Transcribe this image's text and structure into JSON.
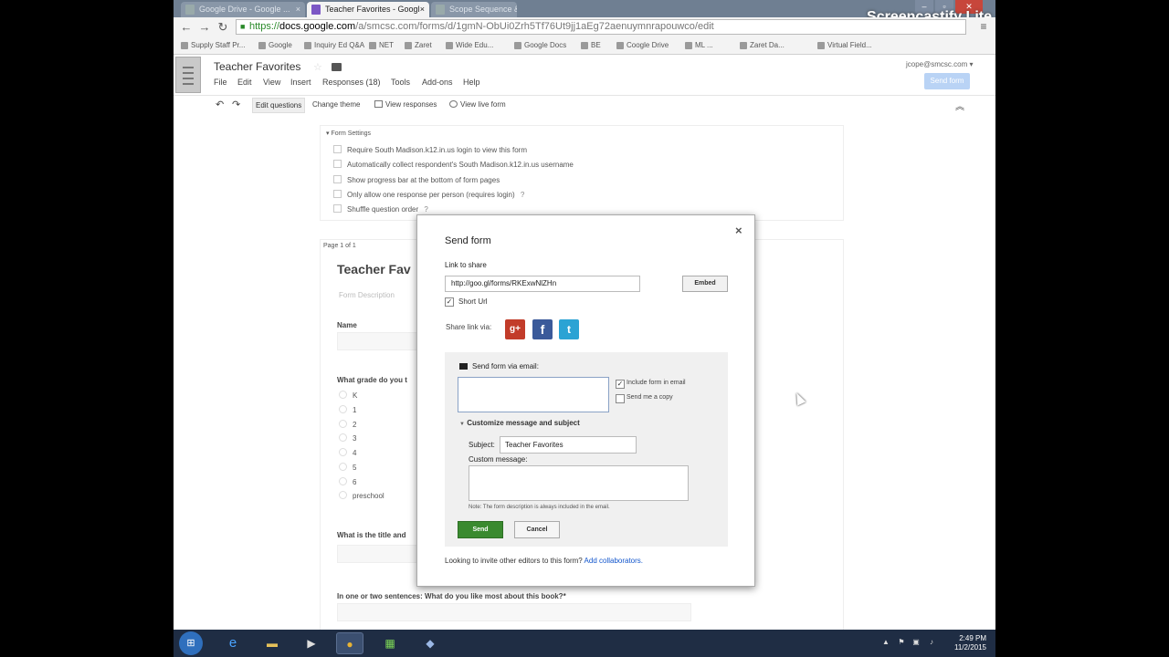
{
  "browser": {
    "tabs": [
      {
        "label": "Teacher Favorites - Googl",
        "active": true
      },
      {
        "label": "Scope Sequence & Ho...",
        "active": false
      },
      {
        "label": "Google Drive - Google ...",
        "active": false
      }
    ],
    "url_scheme": "https://",
    "url_domain": "docs.google.com",
    "url_path": "/a/smcsc.com/forms/d/1gmN-ObUi0Zrh5Tf76Ut9jj1aEg72aenuymnrapouwco/edit",
    "overlay_brand": "Screencastify Lite",
    "bookmarks": [
      "Supply Staff Pr...",
      "Google",
      "Inquiry Ed Q&A",
      "NET",
      "Zaret",
      "Wide Edu...",
      "Google Docs",
      "BE",
      "Coogle Drive",
      "ML ...",
      "Zaret Da...",
      "Virtual Field..."
    ]
  },
  "app": {
    "doc_title": "Teacher Favorites",
    "menu": [
      "File",
      "Edit",
      "View",
      "Insert",
      "Responses (18)",
      "Tools",
      "Add-ons",
      "Help"
    ],
    "account": "jcope@smcsc.com",
    "send_form_label": "Send form"
  },
  "edit_toolbar": {
    "edit_questions": "Edit questions",
    "change_theme": "Change theme",
    "view_responses": "View responses",
    "view_live_form": "View live form"
  },
  "settings": {
    "title": "Form Settings",
    "rows": [
      "Require South Madison.k12.in.us login to view this form",
      "Automatically collect respondent's South Madison.k12.in.us username",
      "Show progress bar at the bottom of form pages",
      "Only allow one response per person (requires login)",
      "Shuffle question order"
    ],
    "help_mark": "?"
  },
  "form": {
    "page_of": "Page 1 of 1",
    "title": "Teacher Fav",
    "description": "Form Description",
    "q_name": "Name",
    "q_grade": "What grade do you t",
    "grade_options": [
      "K",
      "1",
      "2",
      "3",
      "4",
      "5",
      "6",
      "preschool"
    ],
    "q_title": "What is the title and",
    "q_sentences": "In one or two sentences: What do you like most about this book?*"
  },
  "dialog": {
    "title": "Send form",
    "close": "×",
    "link_label": "Link to share",
    "link_value": "http://goo.gl/forms/RKExwNlZHn",
    "embed": "Embed",
    "short_url": "Short Url",
    "check_mark": "✓",
    "share_via": "Share link via:",
    "social": {
      "gplus": "g+",
      "facebook": "f",
      "twitter": "t"
    },
    "email_title": "Send form via email:",
    "include_form": "Include form in email",
    "send_copy": "Send me a copy",
    "customize": "Customize message and subject",
    "subject_label": "Subject:",
    "subject_value": "Teacher Favorites",
    "custom_message_label": "Custom message:",
    "note": "Note: The form description is always included in the email.",
    "send": "Send",
    "cancel": "Cancel",
    "invite_text": "Looking to invite other editors to this form?",
    "invite_link": "Add collaborators."
  },
  "taskbar": {
    "time": "2:49 PM",
    "date": "11/2/2015"
  }
}
